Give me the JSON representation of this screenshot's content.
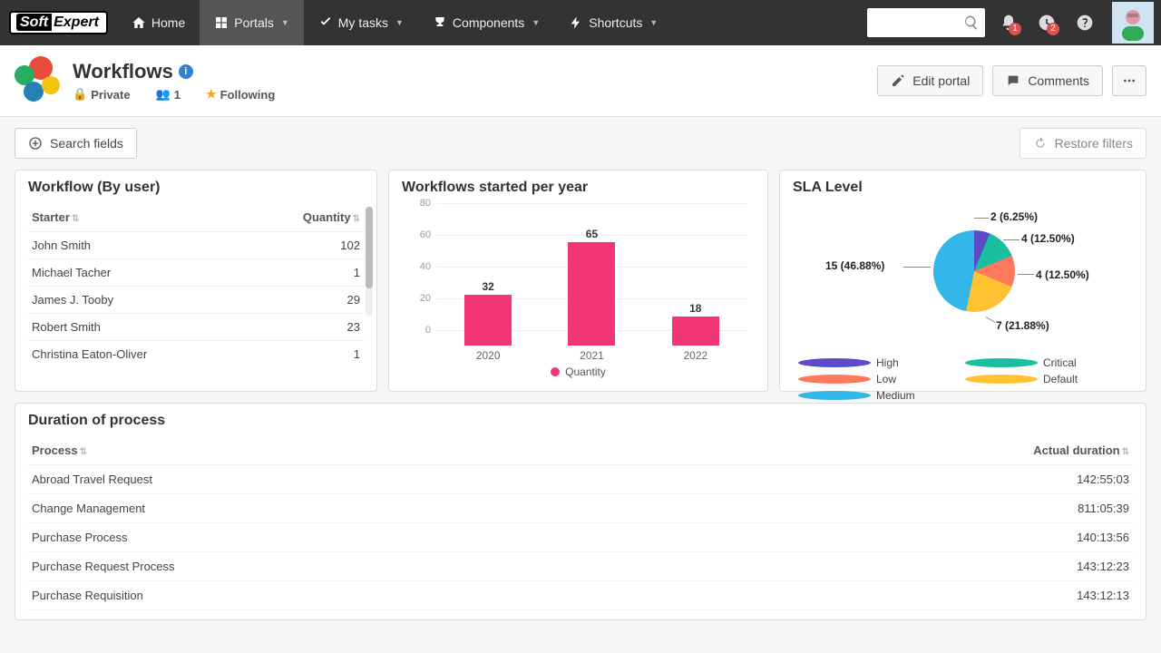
{
  "nav": {
    "home": "Home",
    "portals": "Portals",
    "mytasks": "My tasks",
    "components": "Components",
    "shortcuts": "Shortcuts",
    "bell_badge": "1",
    "clock_badge": "2"
  },
  "page": {
    "title": "Workflows",
    "privacy": "Private",
    "members": "1",
    "following": "Following",
    "edit_btn": "Edit portal",
    "comments_btn": "Comments"
  },
  "filters": {
    "search_fields": "Search fields",
    "restore": "Restore filters"
  },
  "panel_user": {
    "title": "Workflow (By user)",
    "col_starter": "Starter",
    "col_qty": "Quantity",
    "rows": [
      {
        "name": "John Smith",
        "qty": "102"
      },
      {
        "name": "Michael Tacher",
        "qty": "1"
      },
      {
        "name": "James J. Tooby",
        "qty": "29"
      },
      {
        "name": "Robert Smith",
        "qty": "23"
      },
      {
        "name": "Christina Eaton-Oliver",
        "qty": "1"
      }
    ]
  },
  "panel_year": {
    "title": "Workflows started per year",
    "legend": "Quantity"
  },
  "panel_sla": {
    "title": "SLA Level",
    "labels": {
      "l0": "2 (6.25%)",
      "l1": "4 (12.50%)",
      "l2": "4 (12.50%)",
      "l3": "7 (21.88%)",
      "l4": "15 (46.88%)"
    },
    "legend": {
      "high": "High",
      "critical": "Critical",
      "low": "Low",
      "default": "Default",
      "medium": "Medium"
    }
  },
  "panel_dur": {
    "title": "Duration of process",
    "col_proc": "Process",
    "col_dur": "Actual duration",
    "rows": [
      {
        "p": "Abroad Travel Request",
        "d": "142:55:03"
      },
      {
        "p": "Change Management",
        "d": "811:05:39"
      },
      {
        "p": "Purchase Process",
        "d": "140:13:56"
      },
      {
        "p": "Purchase Request Process",
        "d": "143:12:23"
      },
      {
        "p": "Purchase Requisition",
        "d": "143:12:13"
      }
    ]
  },
  "chart_data": [
    {
      "type": "bar",
      "title": "Workflows started per year",
      "categories": [
        "2020",
        "2021",
        "2022"
      ],
      "series": [
        {
          "name": "Quantity",
          "values": [
            32,
            65,
            18
          ]
        }
      ],
      "ylim": [
        0,
        80
      ],
      "yticks": [
        0,
        20,
        40,
        60,
        80
      ]
    },
    {
      "type": "pie",
      "title": "SLA Level",
      "series": [
        {
          "name": "High",
          "value": 2,
          "pct": 6.25,
          "color": "#5b4ac9"
        },
        {
          "name": "Critical",
          "value": 4,
          "pct": 12.5,
          "color": "#18bfa0"
        },
        {
          "name": "Low",
          "value": 4,
          "pct": 12.5,
          "color": "#ff7a5c"
        },
        {
          "name": "Default",
          "value": 7,
          "pct": 21.88,
          "color": "#ffc233"
        },
        {
          "name": "Medium",
          "value": 15,
          "pct": 46.88,
          "color": "#33b7e8"
        }
      ]
    }
  ]
}
